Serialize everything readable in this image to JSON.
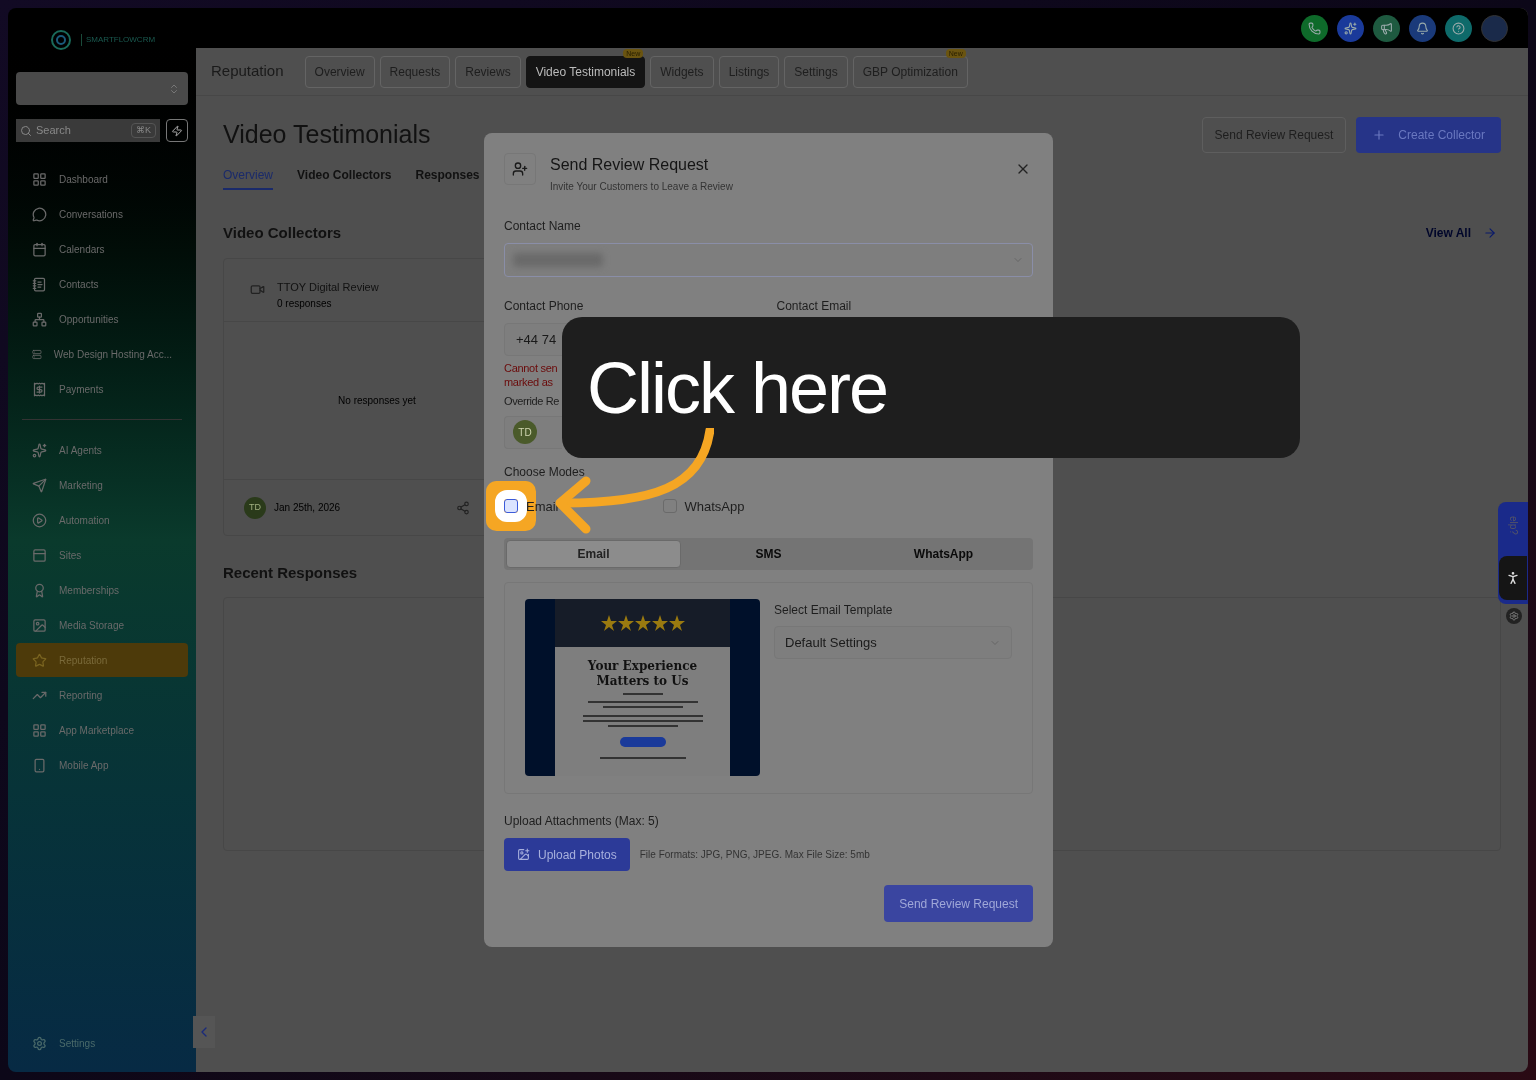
{
  "sidebar": {
    "logo_text": "SMARTFLOWCRM",
    "search": {
      "placeholder": "Search",
      "shortcut": "⌘K"
    },
    "groups": [
      [
        {
          "label": "Dashboard",
          "selected": false
        },
        {
          "label": "Conversations",
          "selected": false
        },
        {
          "label": "Calendars",
          "selected": false
        },
        {
          "label": "Contacts",
          "selected": false
        },
        {
          "label": "Opportunities",
          "selected": false
        },
        {
          "label": "Web Design Hosting Acc...",
          "selected": false
        },
        {
          "label": "Payments",
          "selected": false
        }
      ],
      [
        {
          "label": "AI Agents",
          "selected": false
        },
        {
          "label": "Marketing",
          "selected": false
        },
        {
          "label": "Automation",
          "selected": false
        },
        {
          "label": "Sites",
          "selected": false
        },
        {
          "label": "Memberships",
          "selected": false
        },
        {
          "label": "Media Storage",
          "selected": false
        },
        {
          "label": "Reputation",
          "selected": true
        },
        {
          "label": "Reporting",
          "selected": false
        },
        {
          "label": "App Marketplace",
          "selected": false
        },
        {
          "label": "Mobile App",
          "selected": false
        }
      ]
    ],
    "settings": "Settings"
  },
  "module_nav": {
    "title": "Reputation",
    "tabs": [
      {
        "label": "Overview",
        "selected": false
      },
      {
        "label": "Requests",
        "selected": false
      },
      {
        "label": "Reviews",
        "selected": false
      },
      {
        "label": "Video Testimonials",
        "selected": true,
        "badge": "New"
      },
      {
        "label": "Widgets",
        "selected": false
      },
      {
        "label": "Listings",
        "selected": false
      },
      {
        "label": "Settings",
        "selected": false
      },
      {
        "label": "GBP Optimization",
        "selected": false,
        "badge": "New"
      }
    ]
  },
  "page": {
    "title": "Video Testimonials",
    "actions": [
      "Send Review Request",
      "Create Collector"
    ],
    "subtabs": [
      {
        "label": "Overview",
        "selected": true
      },
      {
        "label": "Video Collectors",
        "selected": false
      },
      {
        "label": "Responses",
        "selected": false
      }
    ],
    "collectors": {
      "title": "Video Collectors",
      "link": "View All",
      "card": {
        "name": "TTOY Digital Review",
        "responses": "0 responses",
        "empty": "No responses yet",
        "avatar": "TD",
        "date": "Jan 25th, 2026"
      }
    },
    "recent": {
      "title": "Recent Responses"
    }
  },
  "modal": {
    "title": "Send Review Request",
    "subtitle": "Invite Your Customers to Leave a Review",
    "contact_name": {
      "label": "Contact Name"
    },
    "contact_phone": {
      "label": "Contact Phone",
      "value": "+44 74",
      "error_lines": [
        "Cannot sen",
        "marked as"
      ]
    },
    "contact_email": {
      "label": "Contact Email"
    },
    "override": {
      "label": "Override Re",
      "avatar": "TD"
    },
    "modes": {
      "label": "Choose Modes",
      "options": [
        {
          "label": "Email",
          "checked": false,
          "highlighted": true
        },
        {
          "label": "WhatsApp",
          "checked": false,
          "highlighted": false
        }
      ]
    },
    "tabs": [
      {
        "label": "Email",
        "selected": true
      },
      {
        "label": "SMS",
        "selected": false
      },
      {
        "label": "WhatsApp",
        "selected": false
      }
    ],
    "template": {
      "preview_heading": "Your Experience Matters to Us",
      "label": "Select Email Template",
      "value": "Default Settings"
    },
    "attachments": {
      "label": "Upload Attachments (Max: 5)",
      "button": "Upload Photos",
      "hint": "File Formats: JPG, PNG, JPEG. Max File Size: 5mb"
    },
    "submit": "Send Review Request"
  },
  "callout": {
    "text": "Click here"
  },
  "help_widget": {
    "text": "elp?"
  }
}
